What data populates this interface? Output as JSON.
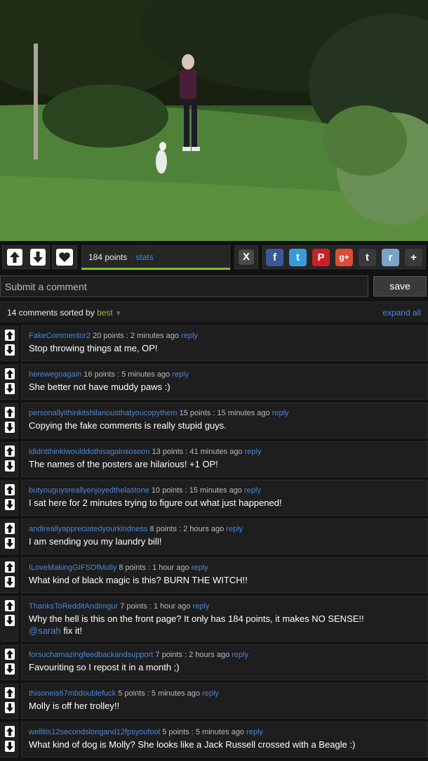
{
  "post": {
    "points": "184 points",
    "separator": "·",
    "stats": "stats",
    "score_fraction": 1.0
  },
  "close_label": "X",
  "share_icons": [
    {
      "name": "facebook-icon",
      "glyph": "f",
      "color": "#3b5998"
    },
    {
      "name": "twitter-icon",
      "glyph": "t",
      "color": "#3a9ad9"
    },
    {
      "name": "pinterest-icon",
      "glyph": "P",
      "color": "#cb2027"
    },
    {
      "name": "google-plus-icon",
      "glyph": "g+",
      "color": "#dd4b39"
    },
    {
      "name": "tumblr-icon",
      "glyph": "t",
      "color": "#3a3a3a"
    },
    {
      "name": "reddit-icon",
      "glyph": "r",
      "color": "#7aa3c8"
    },
    {
      "name": "more-share-icon",
      "glyph": "+",
      "color": "#3a3a3a"
    }
  ],
  "comment_form": {
    "placeholder": "Submit a comment",
    "save_label": "save"
  },
  "comments_header": {
    "count_text": "14 comments sorted by",
    "sort_value": "best",
    "expand_label": "expand all"
  },
  "colors": {
    "accent_green": "#85bf25",
    "link_blue": "#4a86d8"
  },
  "comments": [
    {
      "author": "FakeCommentor2",
      "points": "20 points",
      "time": "2 minutes ago",
      "reply": "reply",
      "text": "Stop throwing things at me, OP!"
    },
    {
      "author": "herewegoagain",
      "points": "16 points",
      "time": "5 minutes ago",
      "reply": "reply",
      "text": "She better not have muddy paws :)"
    },
    {
      "author": "personallyithinkitshilariousthatyoucopythem",
      "points": "15 points",
      "time": "15 minutes ago",
      "reply": "reply",
      "text": "Copying the fake comments is really stupid guys."
    },
    {
      "author": "ididntthinkiwoulddothisagainsosoon",
      "points": "13 points",
      "time": "41 minutes ago",
      "reply": "reply",
      "text": "The names of the posters are hilarious! +1 OP!"
    },
    {
      "author": "butyouguysreallyenjoyedthelastone",
      "points": "10 points",
      "time": "15 minutes ago",
      "reply": "reply",
      "text": "I sat here for 2 minutes trying to figure out what just happened!"
    },
    {
      "author": "andireallyappreciatedyourkindness",
      "points": "8 points",
      "time": "2 hours ago",
      "reply": "reply",
      "text": "I am sending you my laundry bill!"
    },
    {
      "author": "ILoveMakingGIFSOfMolly",
      "points": "8 points",
      "time": "1 hour ago",
      "reply": "reply",
      "text": "What kind of black magic is this? BURN THE WITCH!!"
    },
    {
      "author": "ThanksToRedditAndImgur",
      "points": "7 points",
      "time": "1 hour ago",
      "reply": "reply",
      "text": "Why the hell is this on the front page? It only has 184 points, it makes NO SENSE!!",
      "mention": "@sarah",
      "text2": " fix it!"
    },
    {
      "author": "forsuchamazingfeedbackandsupport",
      "points": "7 points",
      "time": "2 hours ago",
      "reply": "reply",
      "text": "Favouriting so I repost it in a month ;)"
    },
    {
      "author": "thisoneis67mbdoublefuck",
      "points": "5 points",
      "time": "5 minutes ago",
      "reply": "reply",
      "text": "Molly is off her trolley!!"
    },
    {
      "author": "wellitis12secondslongand12fpsyoufool",
      "points": "5 points",
      "time": "5 minutes ago",
      "reply": "reply",
      "text": "What kind of dog is Molly? She looks like a Jack Russell crossed with a Beagle :)"
    }
  ]
}
